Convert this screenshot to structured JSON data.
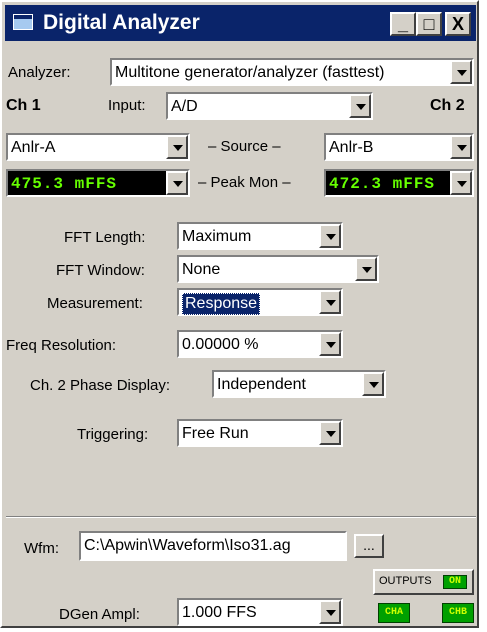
{
  "window": {
    "title": "Digital Analyzer",
    "buttons": {
      "minimize": "_",
      "maximize": "□",
      "close": "X"
    }
  },
  "analyzer": {
    "label": "Analyzer:",
    "value": "Multitone generator/analyzer (fasttest)"
  },
  "channels": {
    "ch1_label": "Ch 1",
    "ch2_label": "Ch 2",
    "input": {
      "label": "Input:",
      "value": "A/D"
    },
    "source": {
      "label": "– Source –",
      "ch1": "Anlr-A",
      "ch2": "Anlr-B"
    },
    "peak_mon": {
      "label": "– Peak Mon –",
      "ch1": "475.3  mFFS",
      "ch2": "472.3  mFFS"
    }
  },
  "settings": {
    "fft_length": {
      "label": "FFT Length:",
      "value": "Maximum"
    },
    "fft_window": {
      "label": "FFT Window:",
      "value": "None"
    },
    "measurement": {
      "label": "Measurement:",
      "value": "Response"
    },
    "freq_resolution": {
      "label": "Freq Resolution:",
      "value": "0.00000  %"
    },
    "phase_display": {
      "label": "Ch. 2 Phase Display:",
      "value": "Independent"
    },
    "triggering": {
      "label": "Triggering:",
      "value": "Free Run"
    }
  },
  "waveform": {
    "label": "Wfm:",
    "value": "C:\\Apwin\\Waveform\\Iso31.ag",
    "browse_label": "..."
  },
  "outputs": {
    "label": "OUTPUTS",
    "on_label": "ON",
    "cha_label": "CHA",
    "chb_label": "CHB"
  },
  "dgen": {
    "label": "DGen Ampl:",
    "value": "1.000   FFS"
  },
  "colors": {
    "titlebar": "#0a246a",
    "led_green": "#00a000",
    "meter_text": "#66ff00"
  }
}
